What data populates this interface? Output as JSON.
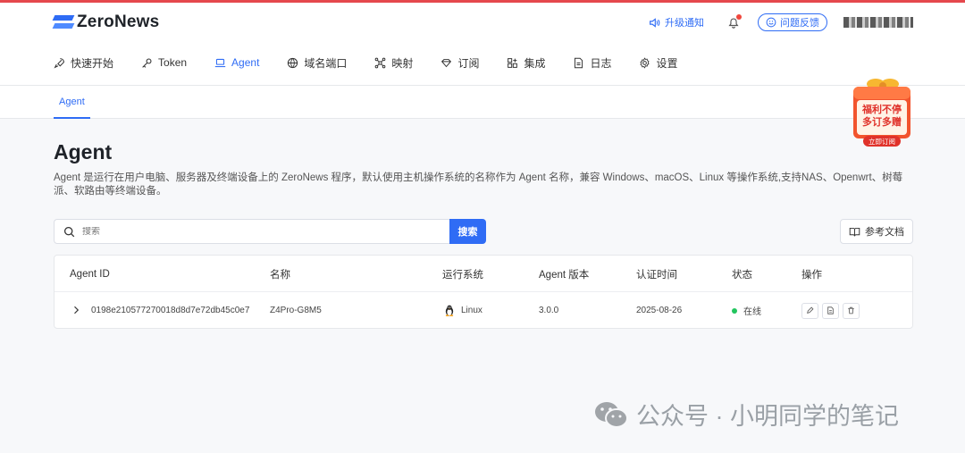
{
  "header": {
    "logo_text": "ZeroNews",
    "upgrade_notice": "升级通知",
    "feedback": "问题反馈"
  },
  "nav": [
    {
      "label": "快速开始",
      "icon": "rocket-icon"
    },
    {
      "label": "Token",
      "icon": "key-icon"
    },
    {
      "label": "Agent",
      "icon": "laptop-icon",
      "active": true
    },
    {
      "label": "域名端口",
      "icon": "globe-icon"
    },
    {
      "label": "映射",
      "icon": "network-icon"
    },
    {
      "label": "订阅",
      "icon": "diamond-icon"
    },
    {
      "label": "集成",
      "icon": "apps-icon"
    },
    {
      "label": "日志",
      "icon": "document-icon"
    },
    {
      "label": "设置",
      "icon": "gear-icon"
    }
  ],
  "subtab": "Agent",
  "promo": {
    "line1": "福利不停",
    "line2": "多订多赠",
    "button": "立即订阅"
  },
  "page": {
    "title": "Agent",
    "description": "Agent 是运行在用户电脑、服务器及终端设备上的 ZeroNews 程序，默认使用主机操作系统的名称作为 Agent 名称，兼容 Windows、macOS、Linux 等操作系统,支持NAS、Openwrt、树莓派、软路由等终端设备。"
  },
  "search": {
    "placeholder": "搜索",
    "button": "搜索"
  },
  "doc_button": "参考文档",
  "table": {
    "columns": [
      "Agent ID",
      "名称",
      "运行系统",
      "Agent 版本",
      "认证时间",
      "状态",
      "操作"
    ],
    "rows": [
      {
        "id": "0198e210577270018d8d7e72db45c0e7",
        "name": "Z4Pro-G8M5",
        "os": "Linux",
        "version": "3.0.0",
        "auth_time": "2025-08-26",
        "status": "在线"
      }
    ]
  },
  "watermark": {
    "text": "公众号 · 小明同学的笔记"
  },
  "colors": {
    "accent": "#2f6cf5",
    "online": "#22c55e",
    "topline": "#e5484d"
  }
}
